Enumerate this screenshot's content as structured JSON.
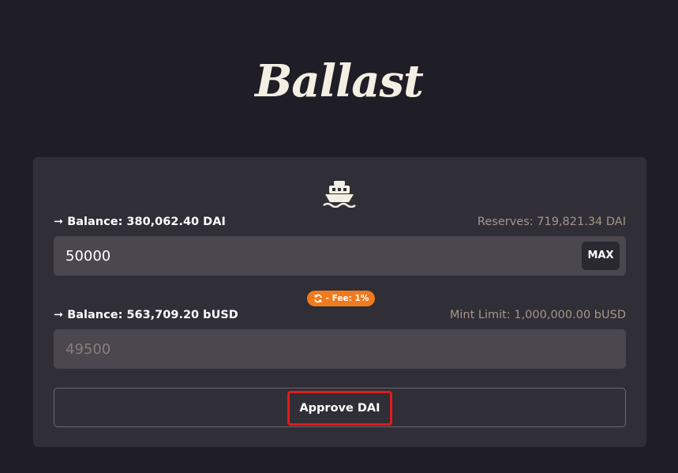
{
  "brand": {
    "logo_text": "Ballast"
  },
  "swap": {
    "from": {
      "arrow": "➞",
      "balance_label": "Balance: 380,062.40 DAI",
      "reserves_label": "Reserves: 719,821.34 DAI",
      "amount_value": "50000",
      "max_label": "MAX"
    },
    "fee": {
      "icon": "refresh-icon",
      "label": "- Fee: 1%"
    },
    "to": {
      "arrow": "➞",
      "balance_label": "Balance: 563,709.20 bUSD",
      "mint_limit_label": "Mint Limit: 1,000,000.00 bUSD",
      "amount_placeholder": "49500"
    },
    "action": {
      "approve_label": "Approve DAI"
    }
  },
  "colors": {
    "background": "#1f1d26",
    "card": "#302e36",
    "field": "#4a474f",
    "accent_orange": "#f07a1e",
    "highlight_red": "#e11b1b"
  }
}
